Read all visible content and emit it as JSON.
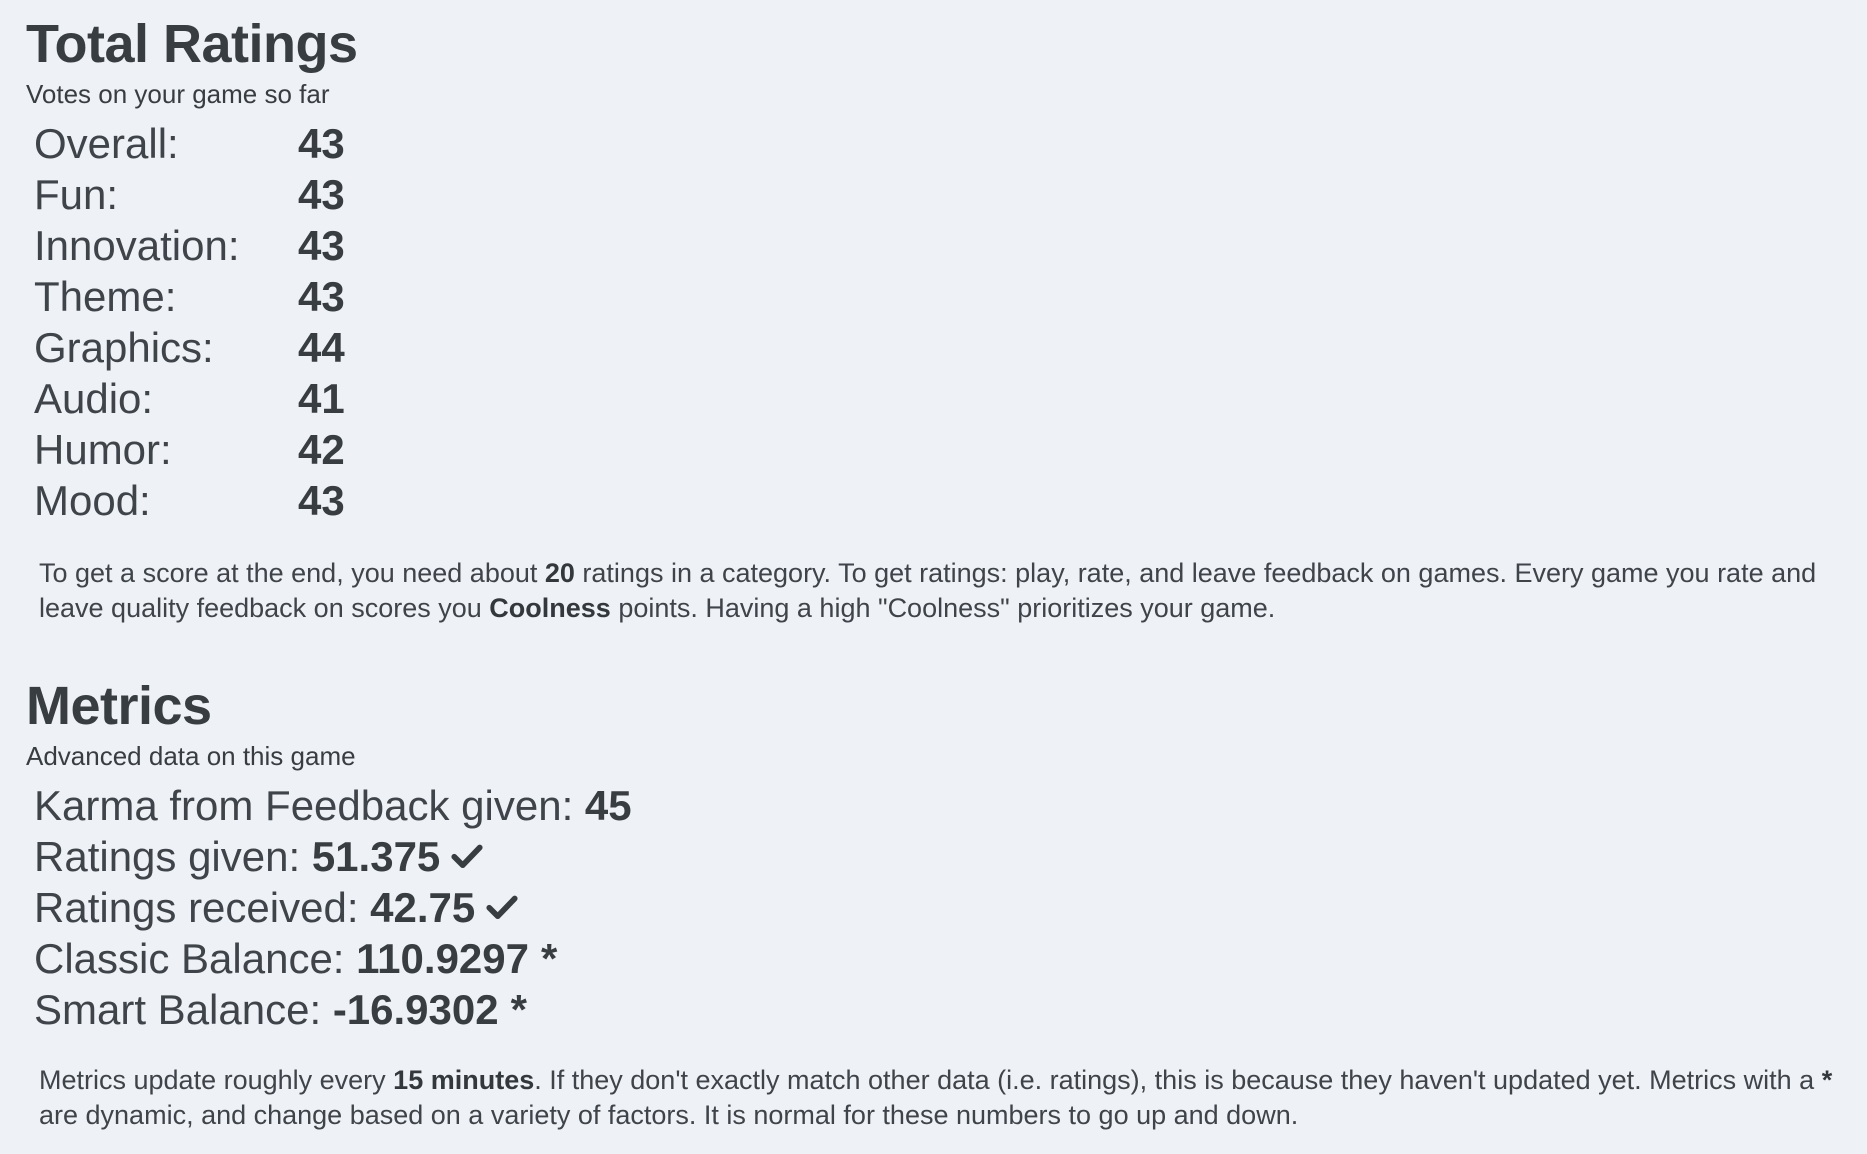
{
  "ratings": {
    "title": "Total Ratings",
    "subtitle": "Votes on your game so far",
    "rows": [
      {
        "label": "Overall:",
        "value": "43"
      },
      {
        "label": "Fun:",
        "value": "43"
      },
      {
        "label": "Innovation:",
        "value": "43"
      },
      {
        "label": "Theme:",
        "value": "43"
      },
      {
        "label": "Graphics:",
        "value": "44"
      },
      {
        "label": "Audio:",
        "value": "41"
      },
      {
        "label": "Humor:",
        "value": "42"
      },
      {
        "label": "Mood:",
        "value": "43"
      }
    ],
    "note": {
      "part1": "To get a score at the end, you need about ",
      "bold1": "20",
      "part2": " ratings in a category. To get ratings: play, rate, and leave feedback on games. Every game you rate and leave quality feedback on scores you ",
      "bold2": "Coolness",
      "part3": " points. Having a high \"Coolness\" prioritizes your game."
    }
  },
  "metrics": {
    "title": "Metrics",
    "subtitle": "Advanced data on this game",
    "rows": [
      {
        "label": "Karma from Feedback given: ",
        "value": "45",
        "suffix_icon": "none"
      },
      {
        "label": "Ratings given: ",
        "value": "51.375",
        "suffix_icon": "check-icon"
      },
      {
        "label": "Ratings received: ",
        "value": "42.75",
        "suffix_icon": "check-icon"
      },
      {
        "label": "Classic Balance: ",
        "value": "110.9297",
        "suffix_text": "*"
      },
      {
        "label": "Smart Balance: ",
        "value": "-16.9302",
        "suffix_text": "*"
      }
    ],
    "note": {
      "part1": "Metrics update roughly every ",
      "bold1": "15 minutes",
      "part2": ". If they don't exactly match other data (i.e. ratings), this is because they haven't updated yet. Metrics with a ",
      "bold2": "*",
      "part3": " are dynamic, and change based on a variety of factors. It is normal for these numbers to go up and down."
    }
  },
  "colors": {
    "background": "#eef1f5",
    "text": "#383d42"
  }
}
